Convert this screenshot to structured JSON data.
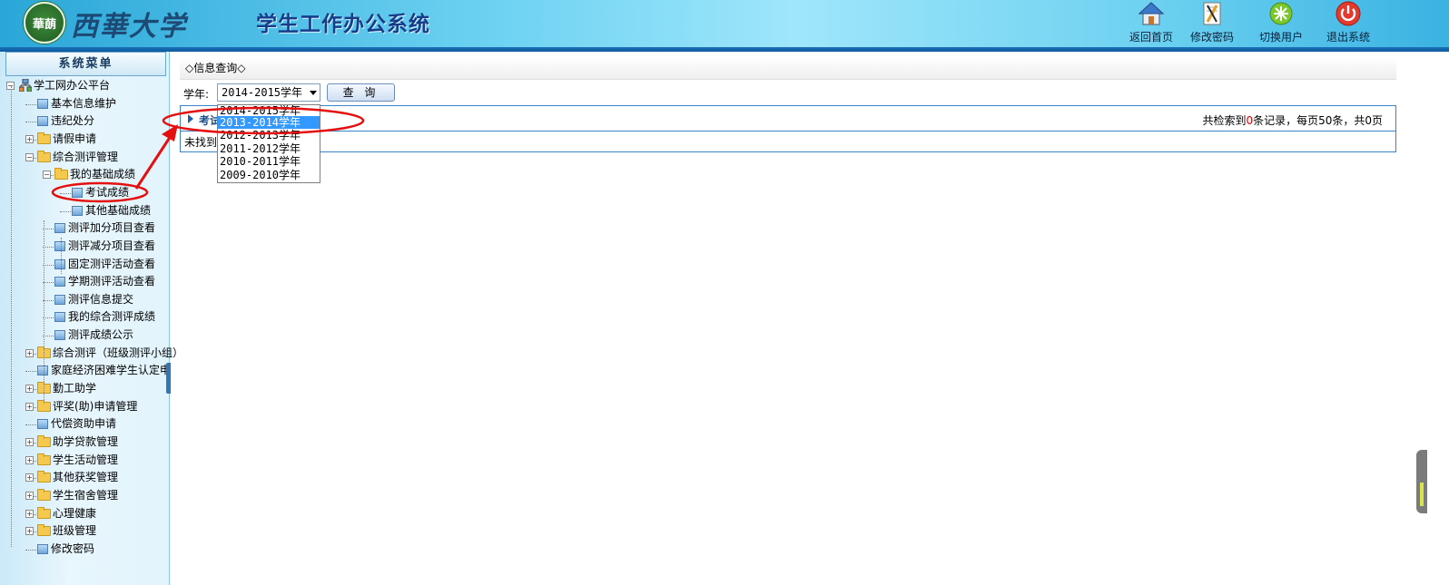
{
  "header": {
    "logo_text": "華蓢",
    "school_name": "西華大学",
    "system_title": "学生工作办公系统",
    "actions": [
      {
        "label": "返回首页",
        "icon": "home-icon"
      },
      {
        "label": "修改密码",
        "icon": "edit-password-icon"
      },
      {
        "label": "切换用户",
        "icon": "switch-user-icon"
      },
      {
        "label": "退出系统",
        "icon": "power-icon"
      }
    ]
  },
  "sidebar": {
    "title": "系统菜单",
    "tree": [
      {
        "label": "学工网办公平台",
        "type": "root"
      },
      {
        "label": "基本信息维护",
        "type": "page"
      },
      {
        "label": "违纪处分",
        "type": "page"
      },
      {
        "label": "请假申请",
        "type": "folder"
      },
      {
        "label": "综合测评管理",
        "type": "folder"
      },
      {
        "label": "我的基础成绩",
        "type": "folder"
      },
      {
        "label": "考试成绩",
        "type": "page"
      },
      {
        "label": "其他基础成绩",
        "type": "page"
      },
      {
        "label": "测评加分项目查看",
        "type": "page"
      },
      {
        "label": "测评减分项目查看",
        "type": "page"
      },
      {
        "label": "固定测评活动查看",
        "type": "page"
      },
      {
        "label": "学期测评活动查看",
        "type": "page"
      },
      {
        "label": "测评信息提交",
        "type": "page"
      },
      {
        "label": "我的综合测评成绩",
        "type": "page"
      },
      {
        "label": "测评成绩公示",
        "type": "page"
      },
      {
        "label": "综合测评（班级测评小组）",
        "type": "folder"
      },
      {
        "label": "家庭经济困难学生认定申",
        "type": "page"
      },
      {
        "label": "勤工助学",
        "type": "folder"
      },
      {
        "label": "评奖(助)申请管理",
        "type": "folder"
      },
      {
        "label": "代偿资助申请",
        "type": "page"
      },
      {
        "label": "助学贷款管理",
        "type": "folder"
      },
      {
        "label": "学生活动管理",
        "type": "folder"
      },
      {
        "label": "其他获奖管理",
        "type": "folder"
      },
      {
        "label": "学生宿舍管理",
        "type": "folder"
      },
      {
        "label": "心理健康",
        "type": "folder"
      },
      {
        "label": "班级管理",
        "type": "folder"
      },
      {
        "label": "修改密码",
        "type": "page"
      }
    ]
  },
  "main": {
    "info_bar": "◇信息查询◇",
    "filter": {
      "label": "学年:",
      "selected": "2014-2015学年",
      "query_button": "查 询",
      "options": [
        "2014-2015学年",
        "2013-2014学年",
        "2012-2013学年",
        "2011-2012学年",
        "2010-2011学年",
        "2009-2010学年"
      ],
      "highlighted_option": "2013-2014学年"
    },
    "result": {
      "title": "考试成绩",
      "stats_prefix": "共检索到",
      "count": "0",
      "stats_suffix": "条记录，每页50条，共0页",
      "empty_message": "未找到相关记录"
    }
  },
  "colors": {
    "header_blue": "#2aa6d8",
    "accent_blue": "#3a83c4",
    "highlight": "#3399ff",
    "annotation_red": "#e41010"
  }
}
